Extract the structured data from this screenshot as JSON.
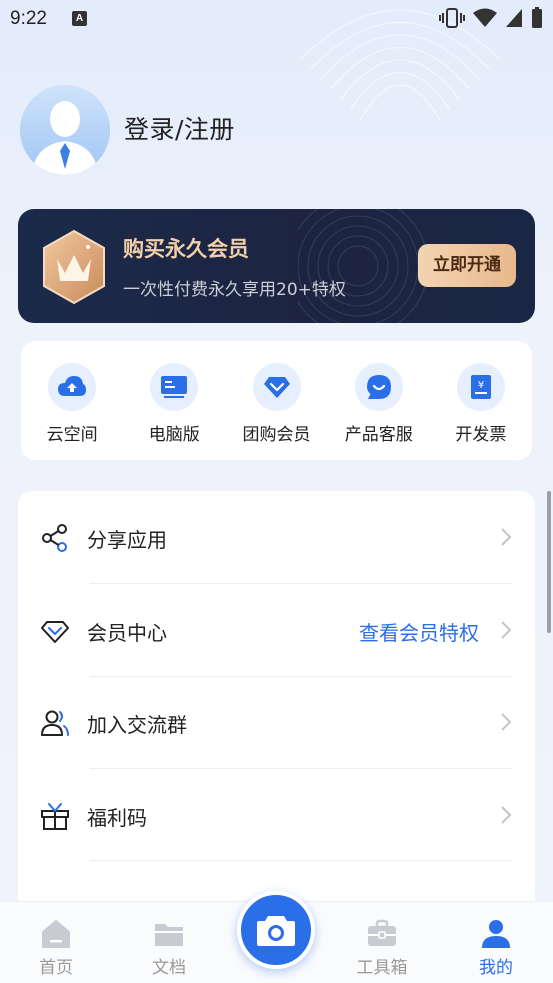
{
  "status_bar": {
    "time": "9:22",
    "notification_letter": "A"
  },
  "profile": {
    "login_text": "登录/注册"
  },
  "vip": {
    "title": "购买永久会员",
    "subtitle": "一次性付费永久享用20+特权",
    "button_label": "立即开通",
    "accent_color": "#f2cfa6"
  },
  "quick_actions": [
    {
      "label": "云空间",
      "icon": "cloud-upload-icon"
    },
    {
      "label": "电脑版",
      "icon": "computer-icon"
    },
    {
      "label": "团购会员",
      "icon": "diamond-icon"
    },
    {
      "label": "产品客服",
      "icon": "chat-icon"
    },
    {
      "label": "开发票",
      "icon": "invoice-icon"
    }
  ],
  "menu": [
    {
      "label": "分享应用",
      "icon": "share-icon"
    },
    {
      "label": "会员中心",
      "icon": "diamond-outline-icon",
      "extra": "查看会员特权"
    },
    {
      "label": "加入交流群",
      "icon": "group-icon"
    },
    {
      "label": "福利码",
      "icon": "gift-icon"
    }
  ],
  "bottom_nav": [
    {
      "label": "首页",
      "icon": "home-icon"
    },
    {
      "label": "文档",
      "icon": "folder-icon"
    },
    {
      "label": "工具箱",
      "icon": "toolbox-icon"
    },
    {
      "label": "我的",
      "icon": "user-icon",
      "active": true
    }
  ],
  "colors": {
    "primary": "#2a6ee8",
    "vip_dark": "#1b2a4a"
  }
}
